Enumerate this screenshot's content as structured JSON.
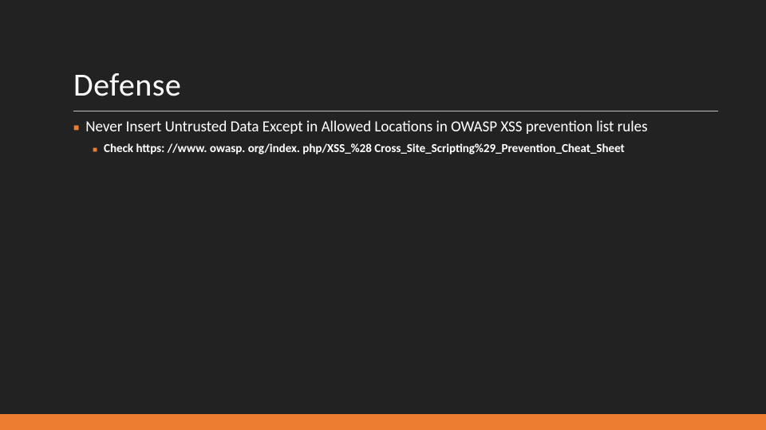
{
  "slide": {
    "title": "Defense",
    "bullets": [
      {
        "text": "Never Insert Untrusted Data Except in Allowed Locations in OWASP XSS prevention list rules",
        "children": [
          {
            "text": "Check https: //www. owasp. org/index. php/XSS_%28 Cross_Site_Scripting%29_Prevention_Cheat_Sheet"
          }
        ]
      }
    ]
  },
  "colors": {
    "background": "#222222",
    "accent": "#ed7d31",
    "text": "#ffffff"
  }
}
